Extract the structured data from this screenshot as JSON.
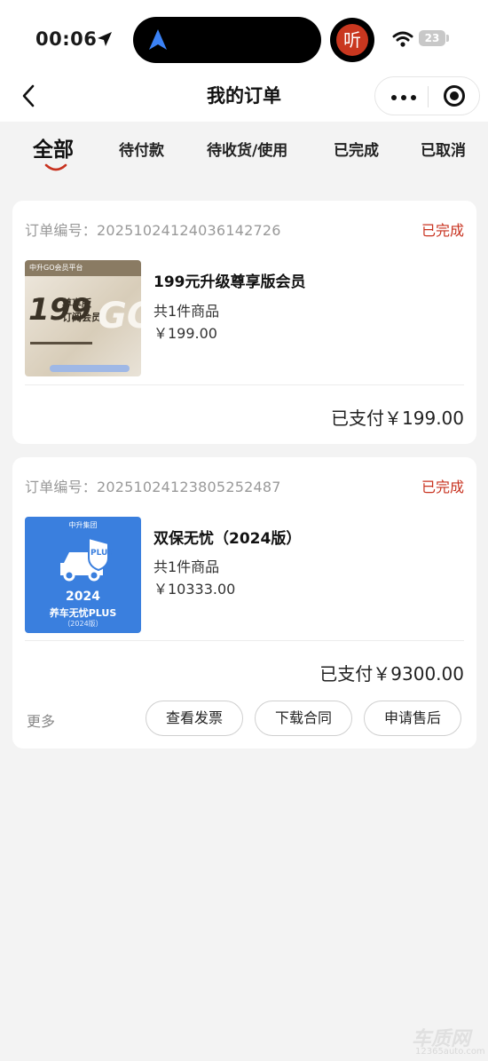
{
  "status_bar": {
    "time": "00:06",
    "app_badge": "听",
    "battery": "23"
  },
  "nav": {
    "title": "我的订单"
  },
  "tabs": [
    {
      "label": "全部",
      "active": true
    },
    {
      "label": "待付款"
    },
    {
      "label": "待收货/使用"
    },
    {
      "label": "已完成"
    },
    {
      "label": "已取消"
    }
  ],
  "orders": [
    {
      "order_no": "订单编号：20251024124036142726",
      "status": "已完成",
      "product_name": "199元升级尊享版会员",
      "count": "共1件商品",
      "price": "￥199.00",
      "paid": "已支付￥199.00",
      "thumb": {
        "brand": "中升GO会员平台",
        "big_number": "199",
        "line1": "尊享版",
        "line2": "订阅会员",
        "go": "GO"
      }
    },
    {
      "order_no": "订单编号：20251024123805252487",
      "status": "已完成",
      "product_name": "双保无忧（2024版）",
      "count": "共1件商品",
      "price": "￥10333.00",
      "paid": "已支付￥9300.00",
      "thumb": {
        "brand": "中升集团",
        "shield": "PLUS",
        "year": "2024",
        "title": "养车无忧PLUS",
        "sub": "（2024版）"
      },
      "actions": {
        "more": "更多",
        "invoice": "查看发票",
        "contract": "下载合同",
        "aftersale": "申请售后"
      }
    }
  ],
  "watermark": {
    "text": "车质网",
    "url": "12365auto.com"
  },
  "colors": {
    "accent": "#c8321f",
    "background": "#f3f3f3",
    "thumb_blue": "#3a7fde"
  }
}
